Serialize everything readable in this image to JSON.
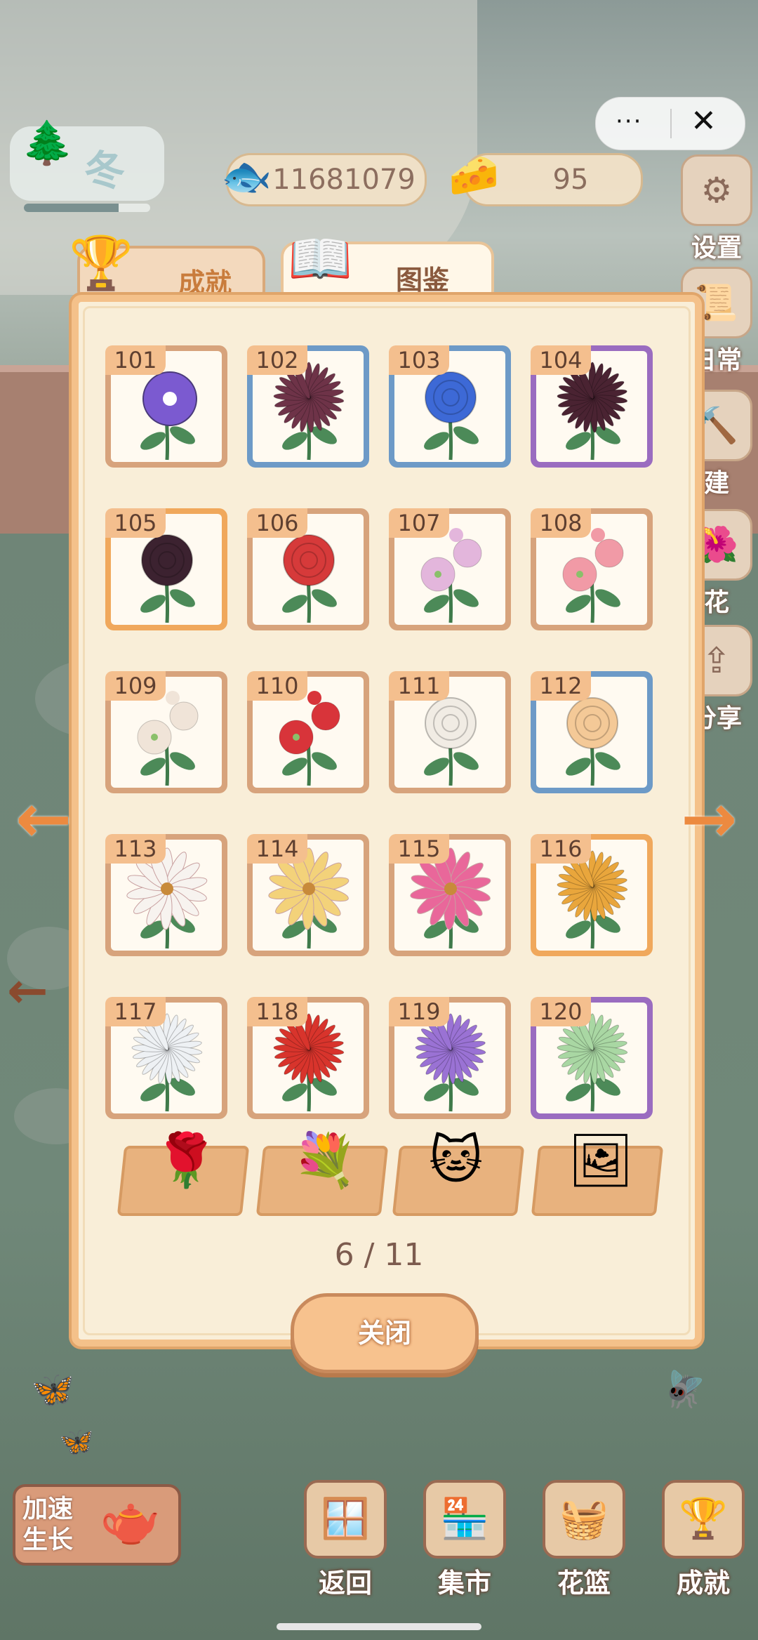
{
  "top": {
    "season": "冬",
    "season_progress": 0.75,
    "fish_currency": "11681079",
    "cheese_currency": "95",
    "menu_dots": "···",
    "close_symbol": "✕"
  },
  "side_menu": [
    {
      "label": "设置",
      "icon": "gear-icon"
    },
    {
      "label": "日常",
      "icon": "scroll-icon"
    },
    {
      "label": "建",
      "icon": "hammer-icon"
    },
    {
      "label": "花",
      "icon": "flower-icon"
    },
    {
      "label": "分享",
      "icon": "share-icon"
    }
  ],
  "tabs": {
    "achievements": "成就",
    "catalog": "图鉴"
  },
  "cards": [
    {
      "id": "101",
      "color": "#7b5ad0",
      "frame": "#d7a37c",
      "kind": "round"
    },
    {
      "id": "102",
      "color": "#6e3348",
      "frame": "#6d9ac7",
      "kind": "spiky"
    },
    {
      "id": "103",
      "color": "#3d69d6",
      "frame": "#6d9ac7",
      "kind": "peony"
    },
    {
      "id": "104",
      "color": "#4a2332",
      "frame": "#9a6cc0",
      "kind": "spiky"
    },
    {
      "id": "105",
      "color": "#3c2230",
      "frame": "#f0a85c",
      "kind": "peony"
    },
    {
      "id": "106",
      "color": "#d63a3a",
      "frame": "#d7a37c",
      "kind": "peony"
    },
    {
      "id": "107",
      "color": "#e3b6dc",
      "frame": "#d7a37c",
      "kind": "hollyhock"
    },
    {
      "id": "108",
      "color": "#f19aa6",
      "frame": "#d7a37c",
      "kind": "hollyhock"
    },
    {
      "id": "109",
      "color": "#f0e4d8",
      "frame": "#d7a37c",
      "kind": "hollyhock"
    },
    {
      "id": "110",
      "color": "#d8343a",
      "frame": "#d7a37c",
      "kind": "hollyhock"
    },
    {
      "id": "111",
      "color": "#f1ece4",
      "frame": "#d7a37c",
      "kind": "peony"
    },
    {
      "id": "112",
      "color": "#f4c997",
      "frame": "#6d9ac7",
      "kind": "peony"
    },
    {
      "id": "113",
      "color": "#f7f3ef",
      "frame": "#d7a37c",
      "kind": "daisy"
    },
    {
      "id": "114",
      "color": "#f3d27a",
      "frame": "#d7a37c",
      "kind": "daisy"
    },
    {
      "id": "115",
      "color": "#e9679a",
      "frame": "#d7a37c",
      "kind": "daisy"
    },
    {
      "id": "116",
      "color": "#e9a63c",
      "frame": "#f0a85c",
      "kind": "spiky"
    },
    {
      "id": "117",
      "color": "#eef1f4",
      "frame": "#d7a37c",
      "kind": "mum"
    },
    {
      "id": "118",
      "color": "#d8342c",
      "frame": "#d7a37c",
      "kind": "mum"
    },
    {
      "id": "119",
      "color": "#9a72d4",
      "frame": "#d7a37c",
      "kind": "mum"
    },
    {
      "id": "120",
      "color": "#a9d7a3",
      "frame": "#9a6cc0",
      "kind": "mum"
    }
  ],
  "filters": [
    {
      "icon": "rose-icon",
      "glyph": "🌹"
    },
    {
      "icon": "bouquet-icon",
      "glyph": "💐"
    },
    {
      "icon": "cat-icon",
      "glyph": "🐱"
    },
    {
      "icon": "photo-icon",
      "glyph": "🖼"
    }
  ],
  "pager": "6 / 11",
  "close_button": "关闭",
  "speed_up": "加速生长",
  "bottom_nav": [
    {
      "label": "返回",
      "icon": "window-icon",
      "glyph": "🪟"
    },
    {
      "label": "集市",
      "icon": "market-icon",
      "glyph": "🏪"
    },
    {
      "label": "花篮",
      "icon": "basket-icon",
      "glyph": "🧺"
    },
    {
      "label": "成就",
      "icon": "trophy-icon",
      "glyph": "🏆"
    }
  ]
}
